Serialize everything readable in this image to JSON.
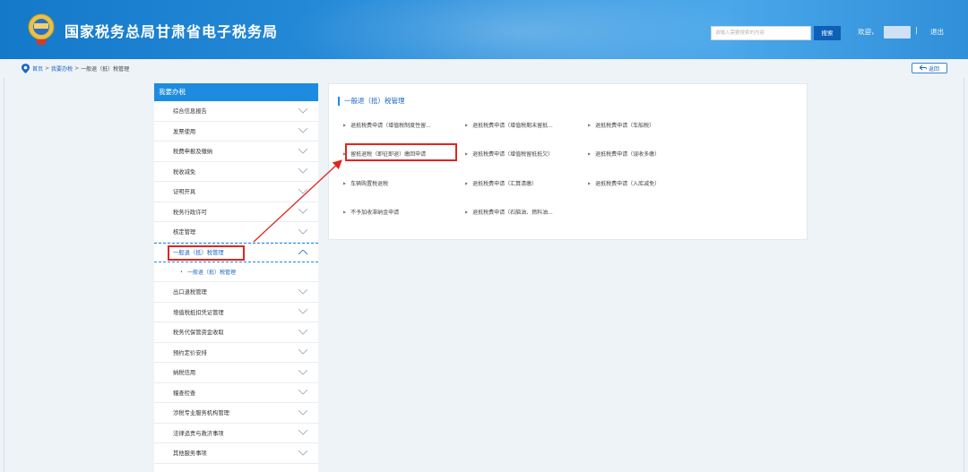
{
  "header": {
    "site_title": "国家税务总局甘肃省电子税务局",
    "search_placeholder": "请输入需要搜索的内容",
    "search_button": "搜索",
    "welcome": "欢迎，",
    "divider": "|",
    "logout": "退出",
    "emblem_icon": "tax-emblem-icon"
  },
  "breadcrumb": {
    "items": [
      "首页",
      "我要办税",
      "一般退（抵）税管理"
    ],
    "separator": ">",
    "back_label": "返回"
  },
  "sidebar": {
    "title": "我要办税",
    "items": [
      {
        "label": "综合信息报告"
      },
      {
        "label": "发票使用"
      },
      {
        "label": "税费申报及缴纳"
      },
      {
        "label": "税收减免"
      },
      {
        "label": "证明开具"
      },
      {
        "label": "税务行政许可"
      },
      {
        "label": "核定管理"
      },
      {
        "label": "一般退（抵）税管理",
        "expanded": true
      },
      {
        "label": "出口退税管理"
      },
      {
        "label": "增值税抵扣凭证管理"
      },
      {
        "label": "税务代保管资金收取"
      },
      {
        "label": "预约定价安排"
      },
      {
        "label": "纳税信用"
      },
      {
        "label": "稽查检查"
      },
      {
        "label": "涉税专业服务机构管理"
      },
      {
        "label": "法律追责与救济事项"
      },
      {
        "label": "其他服务事项"
      }
    ],
    "sub_item": "一般退（抵）税管理"
  },
  "panel": {
    "title": "一般退（抵）税管理",
    "links": [
      [
        "退抵税费申请（增值税制度性留...",
        "退抵税费申请（增值税期末留抵...",
        "退抵税费申请（车船税）"
      ],
      [
        "留抵退税（即征即退）缴回申请",
        "退抵税费申请（增值税留抵抵欠）",
        "退抵税费申请（误收多缴）"
      ],
      [
        "车辆购置税退税",
        "退抵税费申请（汇算清缴）",
        "退抵税费申请（入库减免）"
      ],
      [
        "不予加收滞纳金申请",
        "退抵税费申请（石脑油、燃料油..."
      ]
    ]
  },
  "colors": {
    "header_blue": "#1d8be0",
    "link_blue": "#1a66c2",
    "highlight_red": "#e0261f"
  }
}
